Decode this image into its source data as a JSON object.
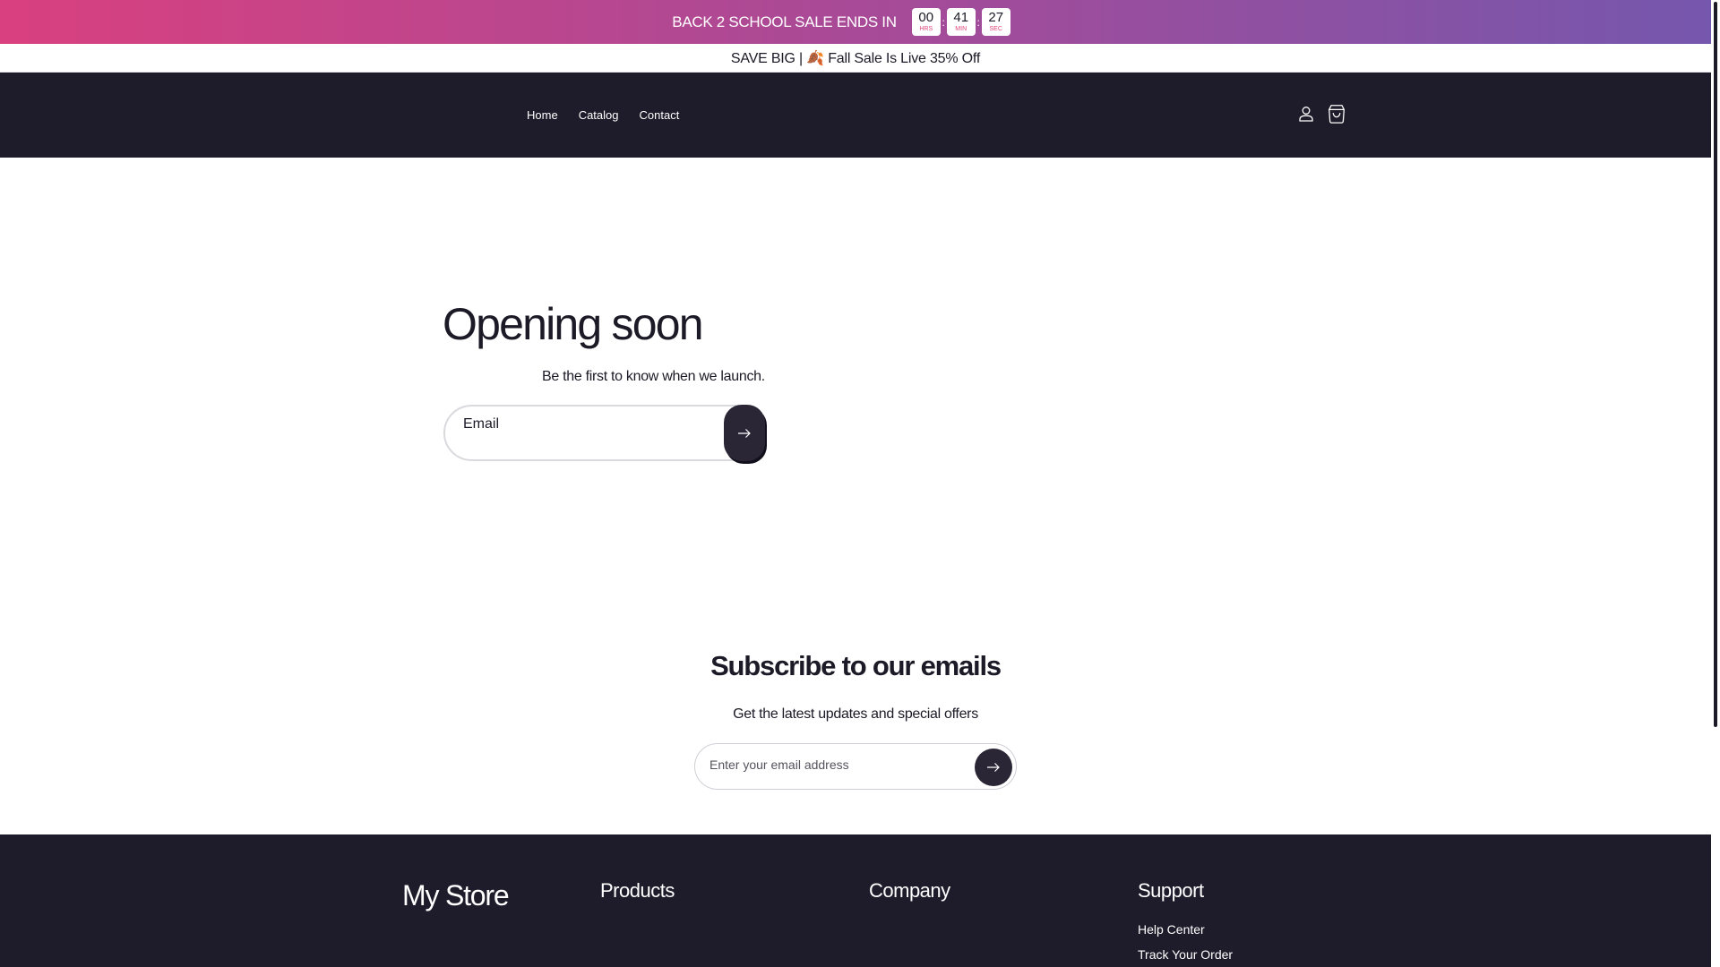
{
  "countdown": {
    "text": "BACK 2 SCHOOL SALE ENDS IN",
    "hours": "00",
    "hours_label": "HRS",
    "minutes": "41",
    "minutes_label": "MIN",
    "seconds": "27",
    "seconds_label": "SEC",
    "separator": ":"
  },
  "announcement": {
    "text": "SAVE BIG | 🍂 Fall Sale Is Live 35% Off"
  },
  "nav": {
    "items": [
      {
        "label": "Home"
      },
      {
        "label": "Catalog"
      },
      {
        "label": "Contact"
      }
    ],
    "icons": [
      "account-icon",
      "cart-icon"
    ]
  },
  "hero": {
    "title": "Opening soon",
    "subtitle": "Be the first to know when we launch.",
    "email_placeholder": "Email"
  },
  "subscribe": {
    "title": "Subscribe to our emails",
    "text": "Get the latest updates and special offers",
    "email_placeholder": "Enter your email address"
  },
  "footer": {
    "brand": "My Store",
    "columns": [
      {
        "title": "Products",
        "links": []
      },
      {
        "title": "Company",
        "links": []
      },
      {
        "title": "Support",
        "links": [
          "Help Center",
          "Track Your Order"
        ]
      }
    ]
  },
  "colors": {
    "gradient_start": "#d9407f",
    "gradient_end": "#7557ad",
    "header_bg": "#1e1b2a",
    "button_bg": "#2a2636"
  }
}
